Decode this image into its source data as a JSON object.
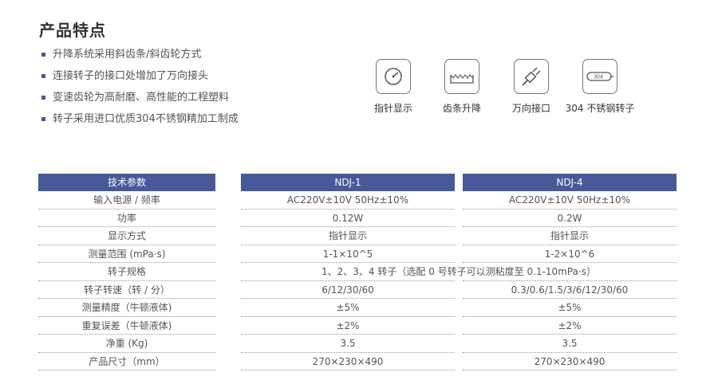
{
  "title": "产品特点",
  "features": [
    "升降系统采用斜齿条/斜齿轮方式",
    "连接转子的接口处增加了万向接头",
    "变速齿轮为高耐磨、高性能的工程塑料",
    "转子采用进口优质304不锈钢精加工制成"
  ],
  "icons": [
    {
      "name": "dial-pointer-icon",
      "label": "指针显示"
    },
    {
      "name": "rack-icon",
      "label": "齿条升降"
    },
    {
      "name": "universal-joint-icon",
      "label": "万向接口"
    },
    {
      "name": "rotor-304-icon",
      "label": "304 不锈钢转子",
      "badge": "304"
    }
  ],
  "table": {
    "headers": [
      "技术参数",
      "NDJ-1",
      "NDJ-4"
    ],
    "rows": [
      {
        "param": "输入电源 / 频率",
        "ndj1": "AC220V±10V 50Hz±10%",
        "ndj4": "AC220V±10V 50Hz±10%"
      },
      {
        "param": "功率",
        "ndj1": "0.12W",
        "ndj4": "0.2W"
      },
      {
        "param": "显示方式",
        "ndj1": "指针显示",
        "ndj4": "指针显示"
      },
      {
        "param": "测量范围 (mPa·s)",
        "ndj1": "1-1×10^5",
        "ndj4": "1-2×10^6"
      },
      {
        "param": "转子规格",
        "span": "1、2、3、4 转子（选配 0 号转子可以测粘度至 0.1-10mPa·s）"
      },
      {
        "param": "转子转速（转 / 分）",
        "ndj1": "6/12/30/60",
        "ndj4": "0.3/0.6/1.5/3/6/12/30/60"
      },
      {
        "param": "测量精度（牛顿液体)",
        "ndj1": "±5%",
        "ndj4": "±5%"
      },
      {
        "param": "重复误差（牛顿液体)",
        "ndj1": "±2%",
        "ndj4": "±2%"
      },
      {
        "param": "净重 (Kg)",
        "ndj1": "3.5",
        "ndj4": "3.5"
      },
      {
        "param": "产品尺寸（mm）",
        "ndj1": "270×230×490",
        "ndj4": "270×230×490"
      }
    ]
  },
  "colors": {
    "header_bg": "#48599a",
    "bullet": "#4a5a8c"
  }
}
